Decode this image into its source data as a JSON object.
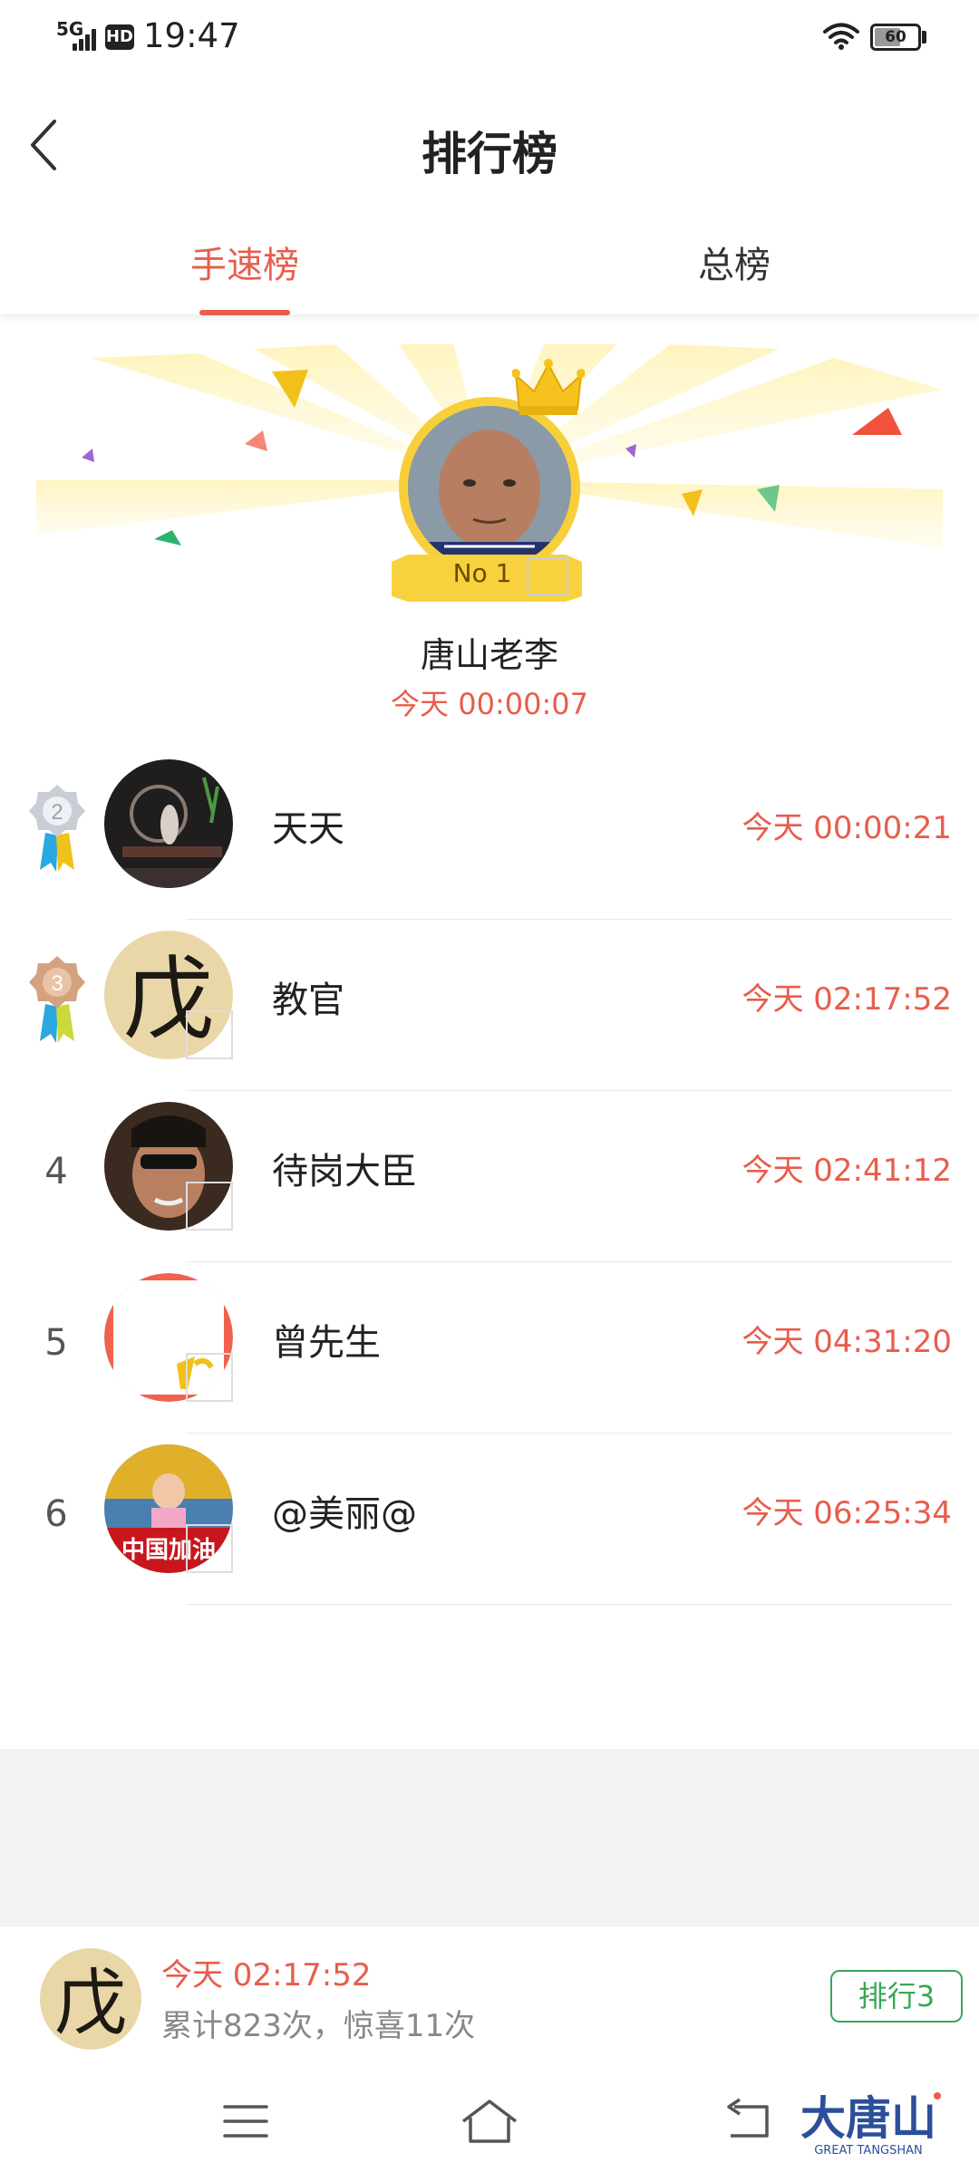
{
  "status_bar": {
    "network": "5G",
    "hd": "HD",
    "time": "19:47",
    "battery": "60",
    "battery_level": 0.6
  },
  "header": {
    "title": "排行榜",
    "back_icon": "chevron-left-icon"
  },
  "tabs": [
    {
      "label": "手速榜",
      "active": true
    },
    {
      "label": "总榜",
      "active": false
    }
  ],
  "champion": {
    "badge": "No 1",
    "name": "唐山老李",
    "time": "今天 00:00:07"
  },
  "rankings": [
    {
      "rank": "2",
      "name": "天天",
      "time": "今天 00:00:21"
    },
    {
      "rank": "3",
      "name": "教官",
      "time": "今天 02:17:52"
    },
    {
      "rank": "4",
      "name": "待岗大臣",
      "time": "今天 02:41:12"
    },
    {
      "rank": "5",
      "name": "曾先生",
      "time": "今天 04:31:20"
    },
    {
      "rank": "6",
      "name": "@美丽@",
      "time": "今天 06:25:34"
    }
  ],
  "my_summary": {
    "time": "今天 02:17:52",
    "stats": "累计823次，惊喜11次",
    "rank_label": "排行3"
  },
  "avatar_texts": {
    "calligraphy": "戊",
    "flag": "中国加油"
  },
  "watermark": {
    "title": "大唐山",
    "subtitle": "GREAT TANGSHAN"
  },
  "colors": {
    "accent": "#e85d4c",
    "gold": "#f7cf3a",
    "green": "#3aa757"
  }
}
